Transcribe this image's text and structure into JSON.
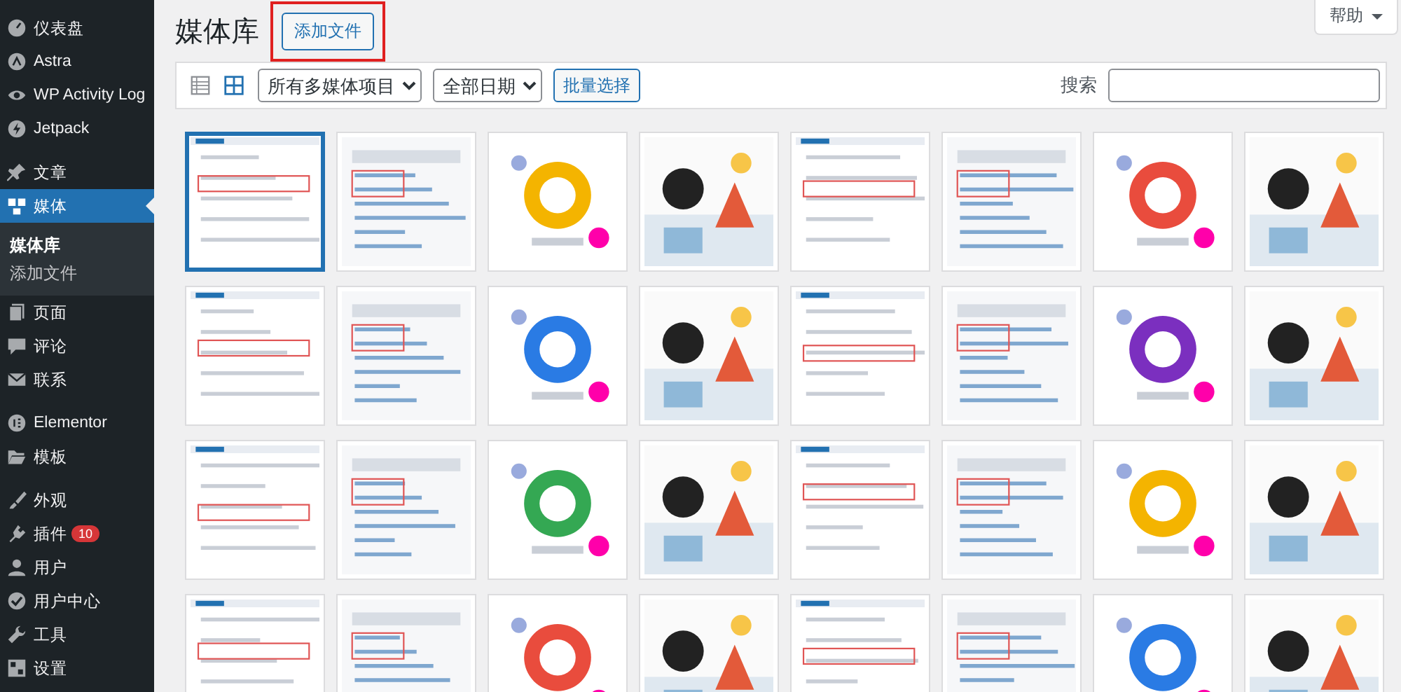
{
  "sidebar": {
    "groups": [
      {
        "items": [
          {
            "label": "仪表盘",
            "selected": false
          },
          {
            "label": "Astra",
            "selected": false
          },
          {
            "label": "WP Activity Log",
            "selected": false
          },
          {
            "label": "Jetpack",
            "selected": false
          }
        ]
      },
      {
        "items": [
          {
            "label": "文章",
            "selected": false
          },
          {
            "label": "媒体",
            "selected": true,
            "children": [
              {
                "label": "媒体库",
                "selected": true
              },
              {
                "label": "添加文件",
                "selected": false
              }
            ]
          },
          {
            "label": "页面",
            "selected": false
          },
          {
            "label": "评论",
            "selected": false
          },
          {
            "label": "联系",
            "selected": false
          }
        ]
      },
      {
        "items": [
          {
            "label": "Elementor",
            "selected": false
          },
          {
            "label": "模板",
            "selected": false
          }
        ]
      },
      {
        "items": [
          {
            "label": "外观",
            "selected": false
          },
          {
            "label": "插件",
            "selected": false,
            "badge": "10"
          },
          {
            "label": "用户",
            "selected": false
          },
          {
            "label": "用户中心",
            "selected": false
          },
          {
            "label": "工具",
            "selected": false
          },
          {
            "label": "设置",
            "selected": false
          }
        ]
      }
    ]
  },
  "header": {
    "title": "媒体库",
    "add_button": {
      "label": "添加文件",
      "highlighted": true
    },
    "help_button": "帮助"
  },
  "toolbar": {
    "view_modes": [
      {
        "kind": "list",
        "selected": false
      },
      {
        "kind": "grid",
        "selected": true
      }
    ],
    "filters": [
      {
        "value": "所有多媒体项目"
      },
      {
        "value": "全部日期"
      }
    ],
    "bulk_button": "批量选择",
    "search_label": "搜索"
  },
  "grid": {
    "items": [
      {
        "kind": "picture",
        "selected": true
      },
      {
        "kind": "picture",
        "selected": false
      },
      {
        "kind": "picture",
        "selected": false
      },
      {
        "kind": "picture",
        "selected": false
      },
      {
        "kind": "picture",
        "selected": false
      },
      {
        "kind": "picture",
        "selected": false
      },
      {
        "kind": "picture",
        "selected": false
      },
      {
        "kind": "picture",
        "selected": false
      },
      {
        "kind": "picture",
        "selected": false
      },
      {
        "kind": "picture",
        "selected": false
      },
      {
        "kind": "picture",
        "selected": false
      },
      {
        "kind": "picture",
        "selected": false
      },
      {
        "kind": "picture",
        "selected": false
      },
      {
        "kind": "picture",
        "selected": false
      },
      {
        "kind": "picture",
        "selected": false
      },
      {
        "kind": "picture",
        "selected": false
      },
      {
        "kind": "picture",
        "selected": false
      },
      {
        "kind": "picture",
        "selected": false
      },
      {
        "kind": "picture",
        "selected": false
      },
      {
        "kind": "picture",
        "selected": false
      },
      {
        "kind": "picture",
        "selected": false
      },
      {
        "kind": "picture",
        "selected": false
      },
      {
        "kind": "picture",
        "selected": false
      },
      {
        "kind": "picture",
        "selected": false
      },
      {
        "kind": "picture",
        "selected": false
      },
      {
        "kind": "picture",
        "selected": false
      },
      {
        "kind": "picture",
        "selected": false
      },
      {
        "kind": "picture",
        "selected": false
      },
      {
        "kind": "picture",
        "selected": false
      },
      {
        "kind": "picture",
        "selected": false
      },
      {
        "kind": "picture",
        "selected": false
      },
      {
        "kind": "picture",
        "selected": false
      }
    ]
  }
}
